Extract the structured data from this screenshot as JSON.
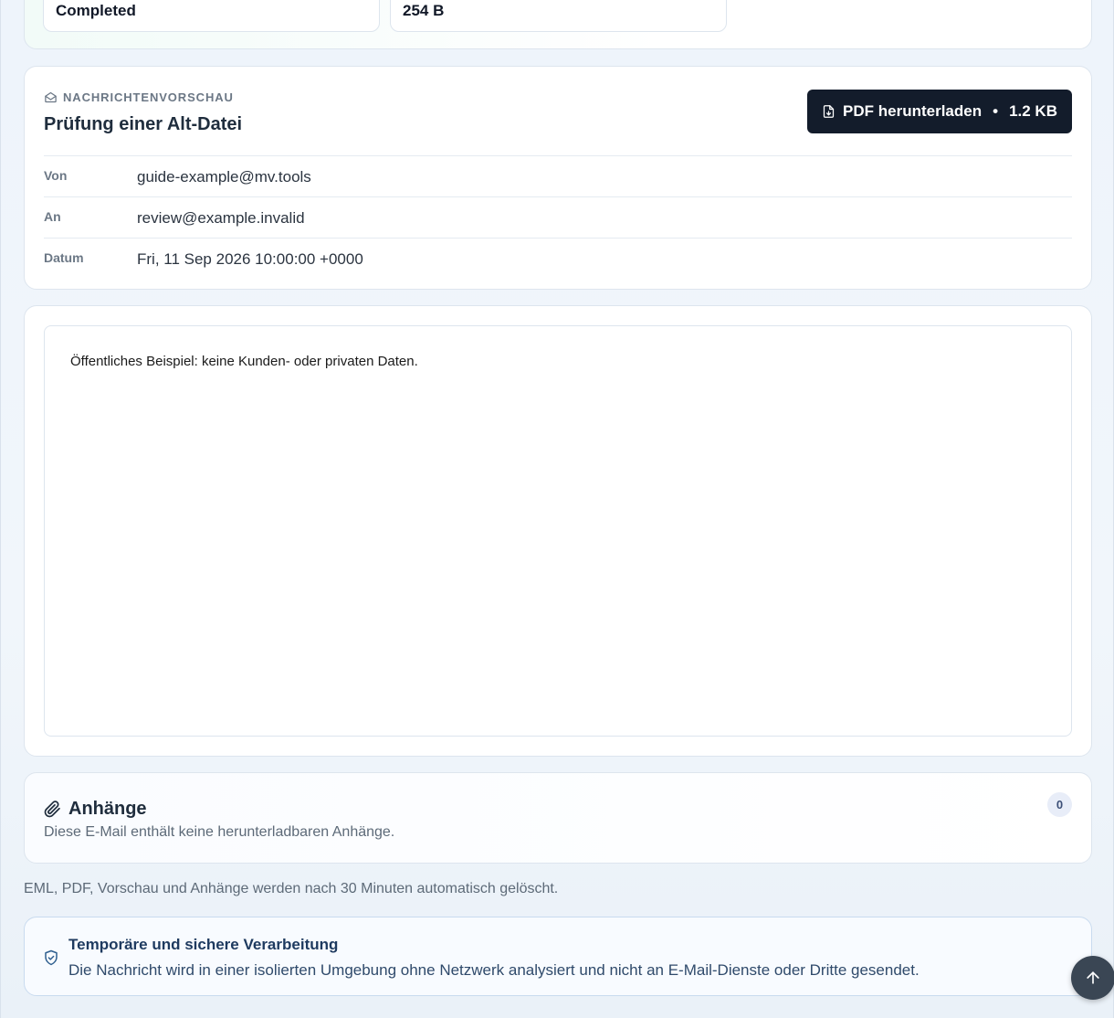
{
  "summary": {
    "status_value": "Completed",
    "size_value": "254 B"
  },
  "preview": {
    "eyebrow": "NACHRICHTENVORSCHAU",
    "subject": "Prüfung einer Alt-Datei",
    "pdf_button_label": "PDF herunterladen",
    "pdf_button_sep": "•",
    "pdf_button_size": "1.2 KB",
    "fields": [
      {
        "label": "Von",
        "value": "guide-example@mv.tools"
      },
      {
        "label": "An",
        "value": "review@example.invalid"
      },
      {
        "label": "Datum",
        "value": "Fri, 11 Sep 2026 10:00:00 +0000"
      }
    ]
  },
  "body": {
    "text": "Öffentliches Beispiel: keine Kunden- oder privaten Daten."
  },
  "attachments": {
    "title": "Anhänge",
    "description": "Diese E-Mail enthält keine herunterladbaren Anhänge.",
    "count": "0"
  },
  "notice": "EML, PDF, Vorschau und Anhänge werden nach 30 Minuten automatisch gelöscht.",
  "secure": {
    "title": "Temporäre und sichere Verarbeitung",
    "description": "Die Nachricht wird in einer isolierten Umgebung ohne Netzwerk analysiert und nicht an E-Mail-Dienste oder Dritte gesendet."
  },
  "icons": {
    "eyebrow": "envelope-open-icon",
    "pdf": "file-download-icon",
    "attachments": "paperclip-icon",
    "secure": "shield-check-icon",
    "scroll_top": "arrow-up-icon"
  },
  "colors": {
    "primary_button": "#131c2b",
    "secure_border": "#c9dbef",
    "badge_bg": "#e8edf8"
  }
}
